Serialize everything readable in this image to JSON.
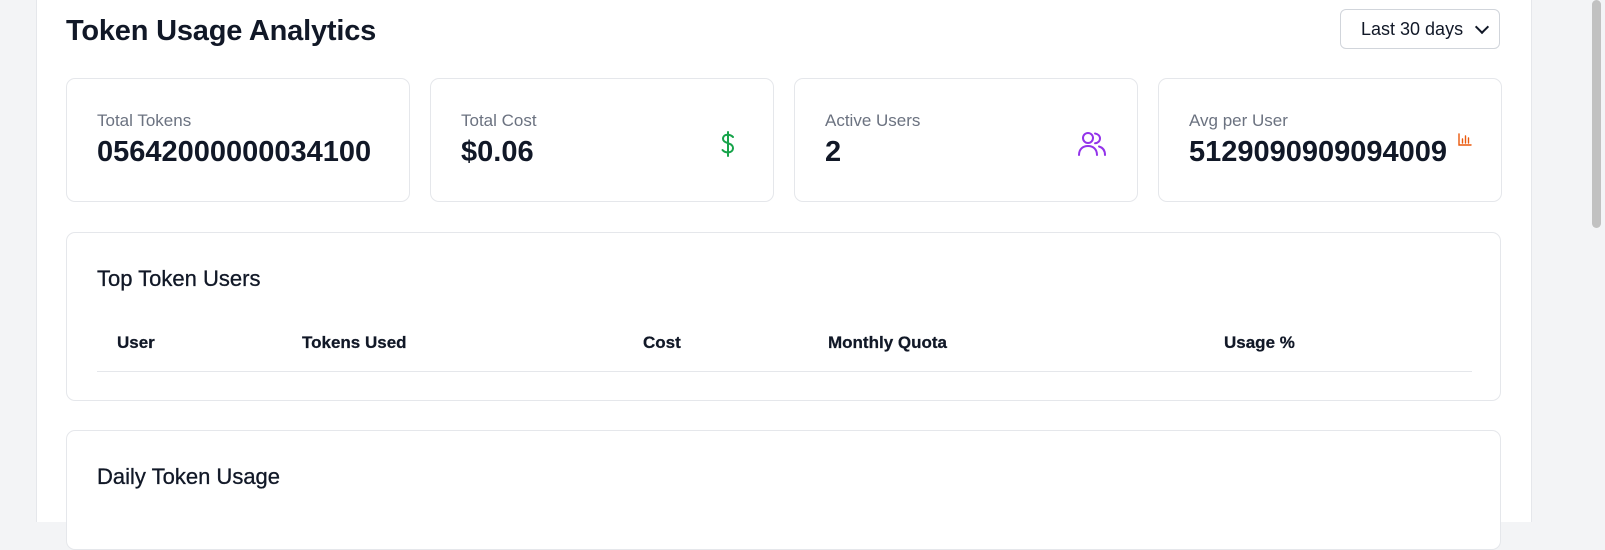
{
  "header": {
    "title": "Token Usage Analytics",
    "range_select": {
      "selected": "Last 30 days"
    }
  },
  "stats": [
    {
      "label": "Total Tokens",
      "value": "05642000000034100",
      "icon": "none"
    },
    {
      "label": "Total Cost",
      "value": "$0.06",
      "icon": "dollar-icon",
      "icon_color": "#16a34a"
    },
    {
      "label": "Active Users",
      "value": "2",
      "icon": "users-icon",
      "icon_color": "#9333ea"
    },
    {
      "label": "Avg per User",
      "value": "5129090909094009",
      "icon": "bar-chart-icon",
      "icon_color": "#ea580c"
    }
  ],
  "top_users": {
    "title": "Top Token Users",
    "columns": [
      "User",
      "Tokens Used",
      "Cost",
      "Monthly Quota",
      "Usage %"
    ],
    "rows": []
  },
  "daily_usage": {
    "title": "Daily Token Usage"
  }
}
